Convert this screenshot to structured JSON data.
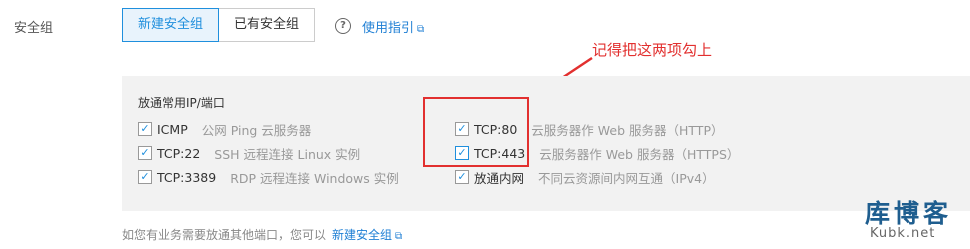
{
  "security_group_label": "安全组",
  "tabs": [
    {
      "label": "新建安全组",
      "active": true
    },
    {
      "label": "已有安全组",
      "active": false
    }
  ],
  "help": {
    "icon": "question-circle-icon",
    "symbol": "?"
  },
  "guide_link": {
    "label": "使用指引",
    "icon": "external-link-icon"
  },
  "annotation": {
    "text": "记得把这两项勾上",
    "color": "#e2302f"
  },
  "panel": {
    "title": "放通常用IP/端口",
    "left_rules": [
      {
        "name": "ICMP",
        "desc": "公网 Ping 云服务器",
        "checked": true
      },
      {
        "name": "TCP:22",
        "desc": "SSH 远程连接 Linux 实例",
        "checked": true
      },
      {
        "name": "TCP:3389",
        "desc": "RDP 远程连接 Windows 实例",
        "checked": true
      }
    ],
    "right_rules": [
      {
        "name": "TCP:80",
        "desc": "云服务器作 Web 服务器（HTTP）",
        "checked": true
      },
      {
        "name": "TCP:443",
        "desc": "云服务器作 Web 服务器（HTTPS）",
        "checked": true
      },
      {
        "name": "放通内网",
        "desc": "不同云资源间内网互通（IPv4）",
        "checked": true
      }
    ]
  },
  "footer": {
    "text": "如您有业务需要放通其他端口，您可以",
    "link_label": "新建安全组"
  },
  "watermark": {
    "cn": "库博客",
    "en": "Kubk.net"
  },
  "colors": {
    "accent": "#1f8fdd",
    "link": "#1f7fd4",
    "annotation": "#e2302f"
  }
}
